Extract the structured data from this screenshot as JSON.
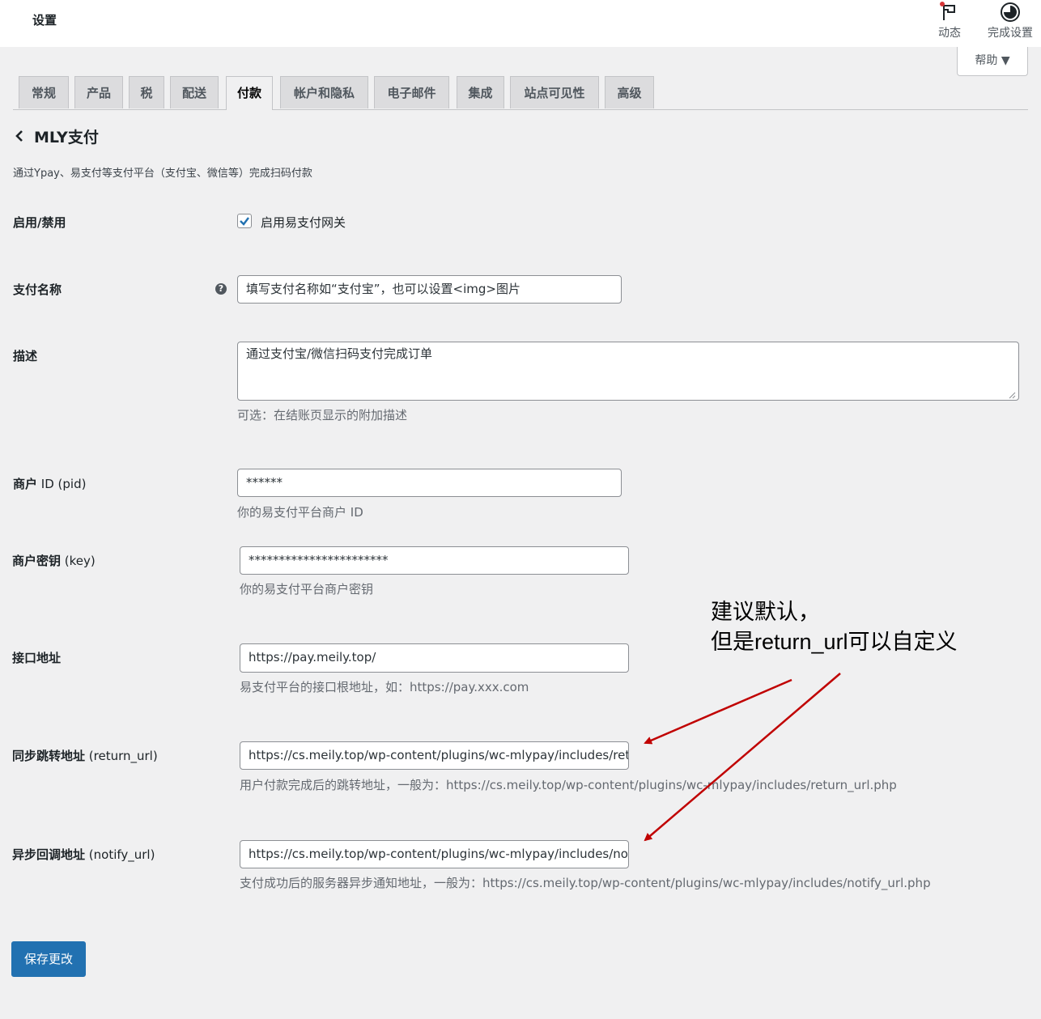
{
  "header": {
    "title": "设置",
    "actions": [
      {
        "label": "动态",
        "icon": "flag-icon"
      },
      {
        "label": "完成设置",
        "icon": "progress-icon"
      }
    ],
    "help_label": "帮助 ▼"
  },
  "tabs": [
    "常规",
    "产品",
    "税",
    "配送",
    "付款",
    "帐户和隐私",
    "电子邮件",
    "集成",
    "站点可见性",
    "高级"
  ],
  "active_tab": "付款",
  "section": {
    "back_icon": "chevron-left-icon",
    "title": "MLY支付",
    "description": "通过Ypay、易支付等支付平台（支付宝、微信等）完成扫码付款"
  },
  "form": {
    "enabled": {
      "label": "启用/禁用",
      "checkbox_label": "启用易支付网关",
      "checked": true
    },
    "title": {
      "label": "支付名称",
      "value": "填写支付名称如“支付宝”，也可以设置<img>图片",
      "help_icon": "question-icon"
    },
    "description": {
      "label": "描述",
      "value": "通过支付宝/微信扫码支付完成订单",
      "hint": "可选：在结账页显示的附加描述"
    },
    "pid": {
      "label_bold": "商户",
      "label_plain": " ID (pid)",
      "value": "******",
      "hint": "你的易支付平台商户 ID"
    },
    "key": {
      "label_bold": "商户密钥",
      "label_plain": " (key)",
      "value": "***********************",
      "hint": "你的易支付平台商户密钥"
    },
    "api_url": {
      "label": "接口地址",
      "value": "https://pay.meily.top/",
      "hint": "易支付平台的接口根地址，如：https://pay.xxx.com"
    },
    "return_url": {
      "label_bold": "同步跳转地址",
      "label_plain": " (return_url)",
      "value": "https://cs.meily.top/wp-content/plugins/wc-mlypay/includes/return_url.php",
      "hint": "用户付款完成后的跳转地址，一般为：https://cs.meily.top/wp-content/plugins/wc-mlypay/includes/return_url.php"
    },
    "notify_url": {
      "label_bold": "异步回调地址",
      "label_plain": " (notify_url)",
      "value": "https://cs.meily.top/wp-content/plugins/wc-mlypay/includes/notify_url.php",
      "hint": "支付成功后的服务器异步通知地址，一般为：https://cs.meily.top/wp-content/plugins/wc-mlypay/includes/notify_url.php"
    }
  },
  "save_label": "保存更改",
  "annotation": {
    "line1": "建议默认，",
    "line2": "但是return_url可以自定义",
    "color": "#c00000"
  }
}
